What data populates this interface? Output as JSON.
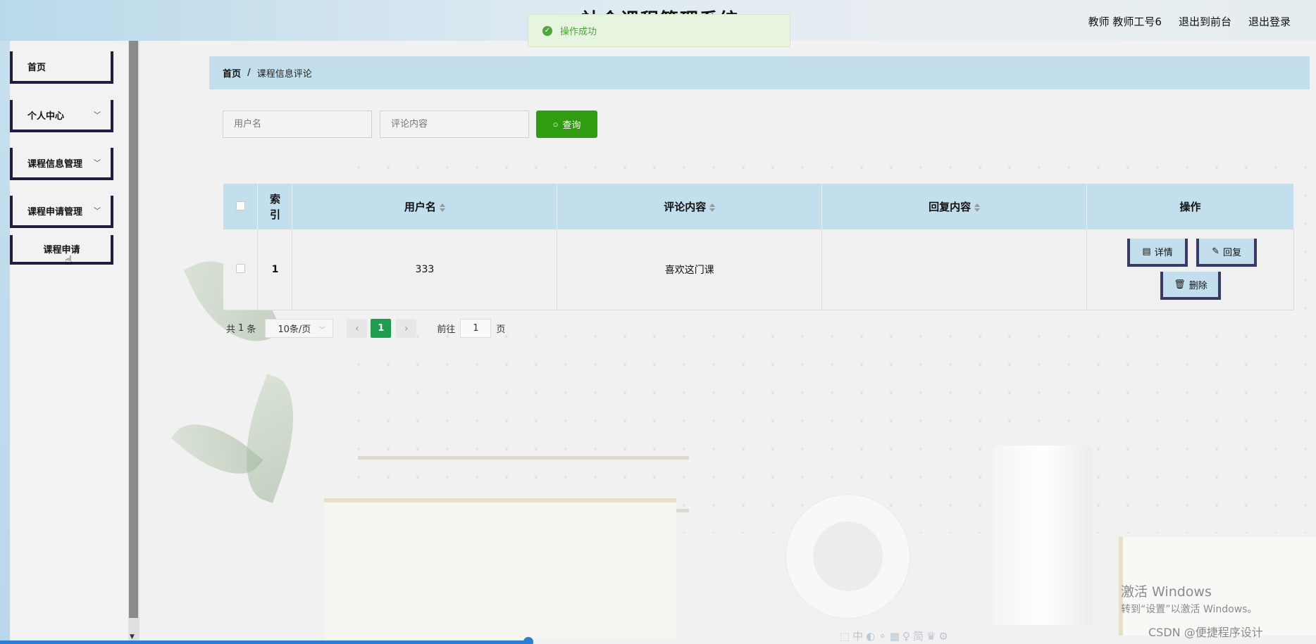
{
  "header": {
    "title": "社会课程管理系统",
    "user_label": "教师 教师工号6",
    "exit_front": "退出到前台",
    "logout": "退出登录"
  },
  "toast": {
    "message": "操作成功"
  },
  "sidebar": {
    "items": [
      {
        "label": "首页"
      },
      {
        "label": "个人中心"
      },
      {
        "label": "课程信息管理"
      },
      {
        "label": "课程申请管理"
      },
      {
        "label": "课程申请"
      }
    ]
  },
  "breadcrumb": {
    "home": "首页",
    "sep": "/",
    "current": "课程信息评论"
  },
  "search": {
    "username_placeholder": "用户名",
    "content_placeholder": "评论内容",
    "button": "查询"
  },
  "table": {
    "headers": {
      "index": "索引",
      "username": "用户名",
      "content": "评论内容",
      "reply": "回复内容",
      "ops": "操作"
    },
    "rows": [
      {
        "index": "1",
        "username": "333",
        "content": "喜欢这门课",
        "reply": ""
      }
    ],
    "op_labels": {
      "detail": "详情",
      "reply": "回复",
      "delete": "删除"
    }
  },
  "pagination": {
    "total_prefix": "共",
    "total": "1",
    "total_suffix": "条",
    "page_size": "10条/页",
    "current_page": "1",
    "goto_label": "前往",
    "goto_value": "1",
    "page_label": "页"
  },
  "watermark": {
    "line1": "激活 Windows",
    "line2": "转到“设置”以激活 Windows。",
    "csdn": "CSDN @便捷程序设计"
  },
  "colors": {
    "accent": "#2f9d0f",
    "header_bg": "#c3dfee",
    "menu_border": "#1f1e3f"
  }
}
